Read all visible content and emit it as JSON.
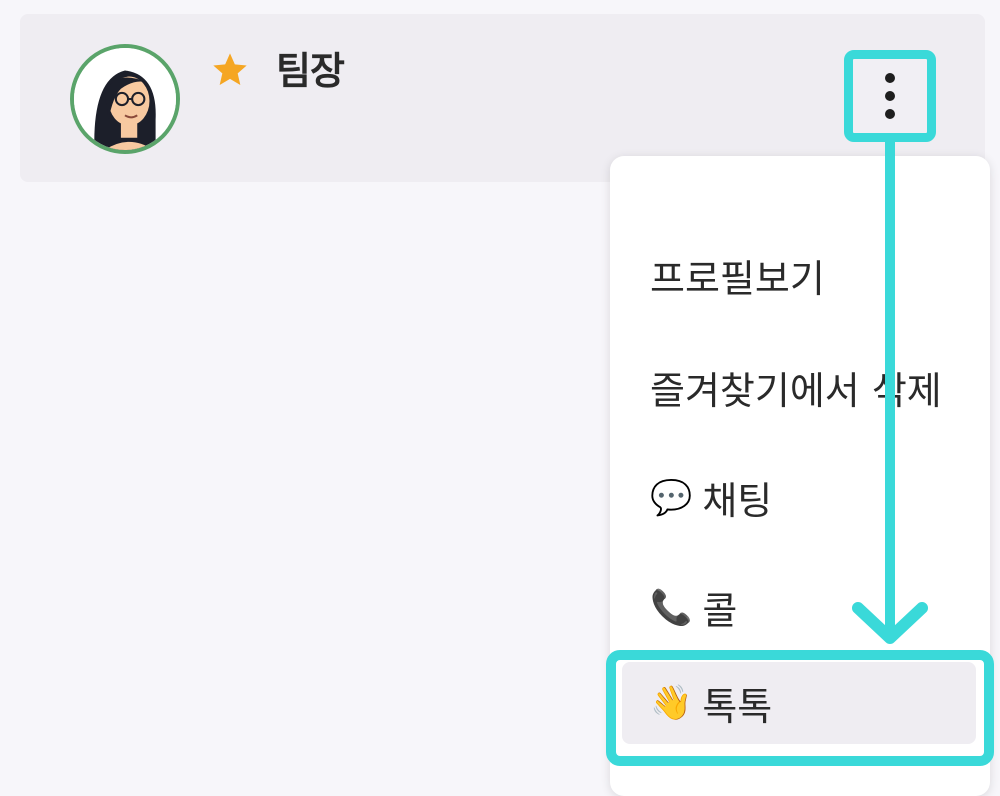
{
  "contact": {
    "name": "팀장",
    "favorite_icon": "star-icon",
    "avatar_icon": "woman-with-glasses-avatar"
  },
  "header": {
    "more_icon": "vertical-ellipsis-icon"
  },
  "menu": {
    "items": [
      {
        "label": "프로필보기",
        "icon": ""
      },
      {
        "label": "즐겨찾기에서 삭제",
        "icon": ""
      },
      {
        "label": "채팅",
        "icon": "💬"
      },
      {
        "label": "콜",
        "icon": "📞"
      },
      {
        "label": "톡톡",
        "icon": "👋"
      }
    ]
  },
  "colors": {
    "highlight": "#3ad9d9",
    "star": "#f5a623",
    "avatar_ring": "#5aa46a"
  }
}
